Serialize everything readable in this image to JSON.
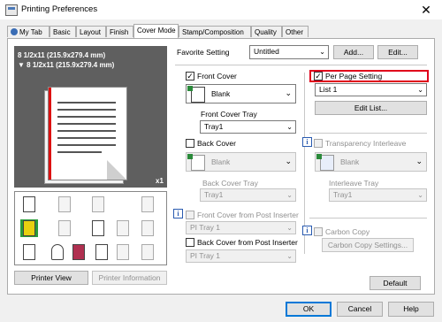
{
  "window": {
    "title": "Printing Preferences",
    "close_glyph": "✕"
  },
  "tabs": [
    {
      "label": "My Tab"
    },
    {
      "label": "Basic"
    },
    {
      "label": "Layout"
    },
    {
      "label": "Finish"
    },
    {
      "label": "Cover Mode"
    },
    {
      "label": "Stamp/Composition"
    },
    {
      "label": "Quality"
    },
    {
      "label": "Other"
    }
  ],
  "active_tab": "Cover Mode",
  "preview": {
    "line1": "8 1/2x11 (215.9x279.4 mm)",
    "line2": "8 1/2x11 (215.9x279.4 mm)",
    "copies": "x1"
  },
  "favorite": {
    "label": "Favorite Setting",
    "value": "Untitled",
    "add_label": "Add...",
    "edit_label": "Edit..."
  },
  "front_cover": {
    "label": "Front Cover",
    "checked": true,
    "option": "Blank",
    "tray_label": "Front Cover Tray",
    "tray_value": "Tray1"
  },
  "back_cover": {
    "label": "Back Cover",
    "checked": false,
    "option": "Blank",
    "tray_label": "Back Cover Tray",
    "tray_value": "Tray1"
  },
  "post_inserter_front": {
    "label": "Front Cover from Post Inserter",
    "value": "PI Tray 1"
  },
  "post_inserter_back": {
    "label": "Back Cover from Post Inserter",
    "value": "PI Tray 1"
  },
  "per_page": {
    "label": "Per Page Setting",
    "checked": true,
    "list_value": "List 1",
    "edit_list_label": "Edit List..."
  },
  "transparency": {
    "label": "Transparency Interleave",
    "option": "Blank",
    "tray_label": "Interleave Tray",
    "tray_value": "Tray1"
  },
  "carbon": {
    "label": "Carbon Copy",
    "settings_label": "Carbon Copy Settings..."
  },
  "buttons": {
    "printer_view": "Printer View",
    "printer_info": "Printer Information",
    "default": "Default",
    "ok": "OK",
    "cancel": "Cancel",
    "help": "Help"
  },
  "icons": {
    "info": "i",
    "check": "✓",
    "dropdown": "⌄"
  },
  "colors": {
    "highlight": "#e0001b",
    "accent": "#0078d7"
  }
}
